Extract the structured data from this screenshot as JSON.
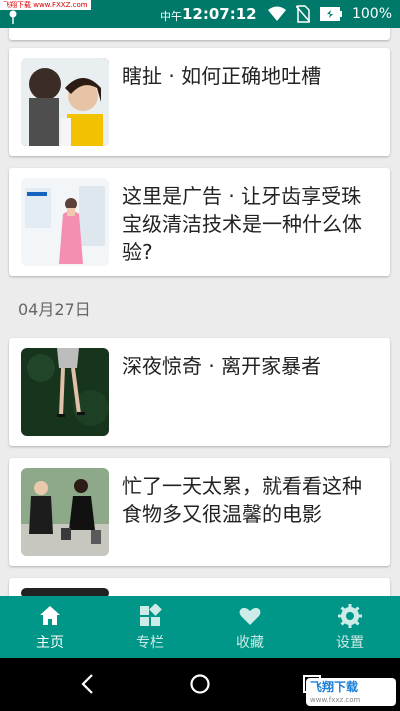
{
  "status_bar": {
    "watermark": "飞翔下载 www.FXXZ.com",
    "ampm": "中午",
    "time": "12:07:12",
    "battery_pct": "100%"
  },
  "feed": {
    "items": [
      {
        "title": "瞎扯 · 如何正确地吐槽"
      },
      {
        "title": "这里是广告 · 让牙齿享受珠宝级清洁技术是一种什么体验?"
      },
      {
        "title": "深夜惊奇 · 离开家暴者"
      },
      {
        "title": "忙了一天太累，就看看这种食物多又很温馨的电影"
      }
    ],
    "date_label": "04月27日"
  },
  "tabbar": {
    "tabs": [
      {
        "label": "主页",
        "icon": "home-icon",
        "active": true
      },
      {
        "label": "专栏",
        "icon": "columns-icon",
        "active": false
      },
      {
        "label": "收藏",
        "icon": "heart-icon",
        "active": false
      },
      {
        "label": "设置",
        "icon": "gear-icon",
        "active": false
      }
    ]
  },
  "badge": {
    "main": "飞翔下载",
    "sub": "www.fxxz.com"
  },
  "colors": {
    "status": "#00796b",
    "tabbar": "#009688"
  }
}
